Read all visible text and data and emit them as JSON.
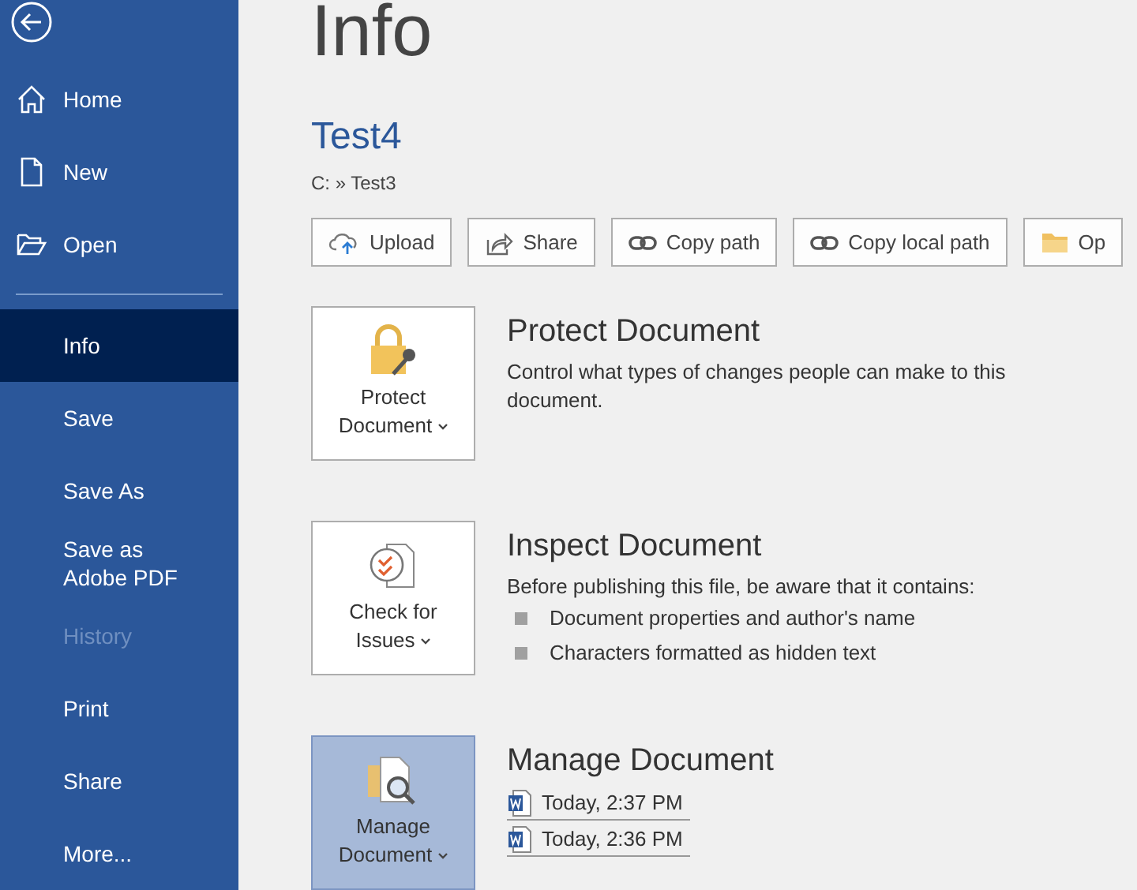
{
  "sidebar": {
    "items": [
      {
        "label": "Home",
        "selected": false,
        "disabled": false,
        "kind": "home"
      },
      {
        "label": "New",
        "selected": false,
        "disabled": false,
        "kind": "new"
      },
      {
        "label": "Open",
        "selected": false,
        "disabled": false,
        "kind": "open"
      },
      {
        "label": "Info",
        "selected": true,
        "disabled": false,
        "kind": "plain"
      },
      {
        "label": "Save",
        "selected": false,
        "disabled": false,
        "kind": "plain"
      },
      {
        "label": "Save As",
        "selected": false,
        "disabled": false,
        "kind": "plain"
      },
      {
        "label": "Save as Adobe PDF",
        "selected": false,
        "disabled": false,
        "kind": "plain"
      },
      {
        "label": "History",
        "selected": false,
        "disabled": true,
        "kind": "plain"
      },
      {
        "label": "Print",
        "selected": false,
        "disabled": false,
        "kind": "plain"
      },
      {
        "label": "Share",
        "selected": false,
        "disabled": false,
        "kind": "plain"
      },
      {
        "label": "More...",
        "selected": false,
        "disabled": false,
        "kind": "plain"
      }
    ]
  },
  "page": {
    "title": "Info",
    "document_name": "Test4",
    "path": "C: » Test3"
  },
  "toolbar": [
    {
      "label": "Upload",
      "kind": "upload"
    },
    {
      "label": "Share",
      "kind": "share"
    },
    {
      "label": "Copy path",
      "kind": "link"
    },
    {
      "label": "Copy local path",
      "kind": "link"
    },
    {
      "label": "Op",
      "kind": "folder"
    }
  ],
  "sections": [
    {
      "kind": "protect",
      "button": [
        "Protect",
        "Document"
      ],
      "selected": false,
      "title": "Protect Document",
      "description": "Control what types of changes people can make to this document."
    },
    {
      "kind": "inspect",
      "button": [
        "Check for",
        "Issues"
      ],
      "selected": false,
      "title": "Inspect Document",
      "description": "Before publishing this file, be aware that it contains:",
      "bullets": [
        "Document properties and author's name",
        "Characters formatted as hidden text"
      ]
    },
    {
      "kind": "manage",
      "button": [
        "Manage",
        "Document"
      ],
      "selected": true,
      "title": "Manage Document",
      "versions": [
        "Today, 2:37 PM",
        "Today, 2:36 PM"
      ]
    }
  ]
}
